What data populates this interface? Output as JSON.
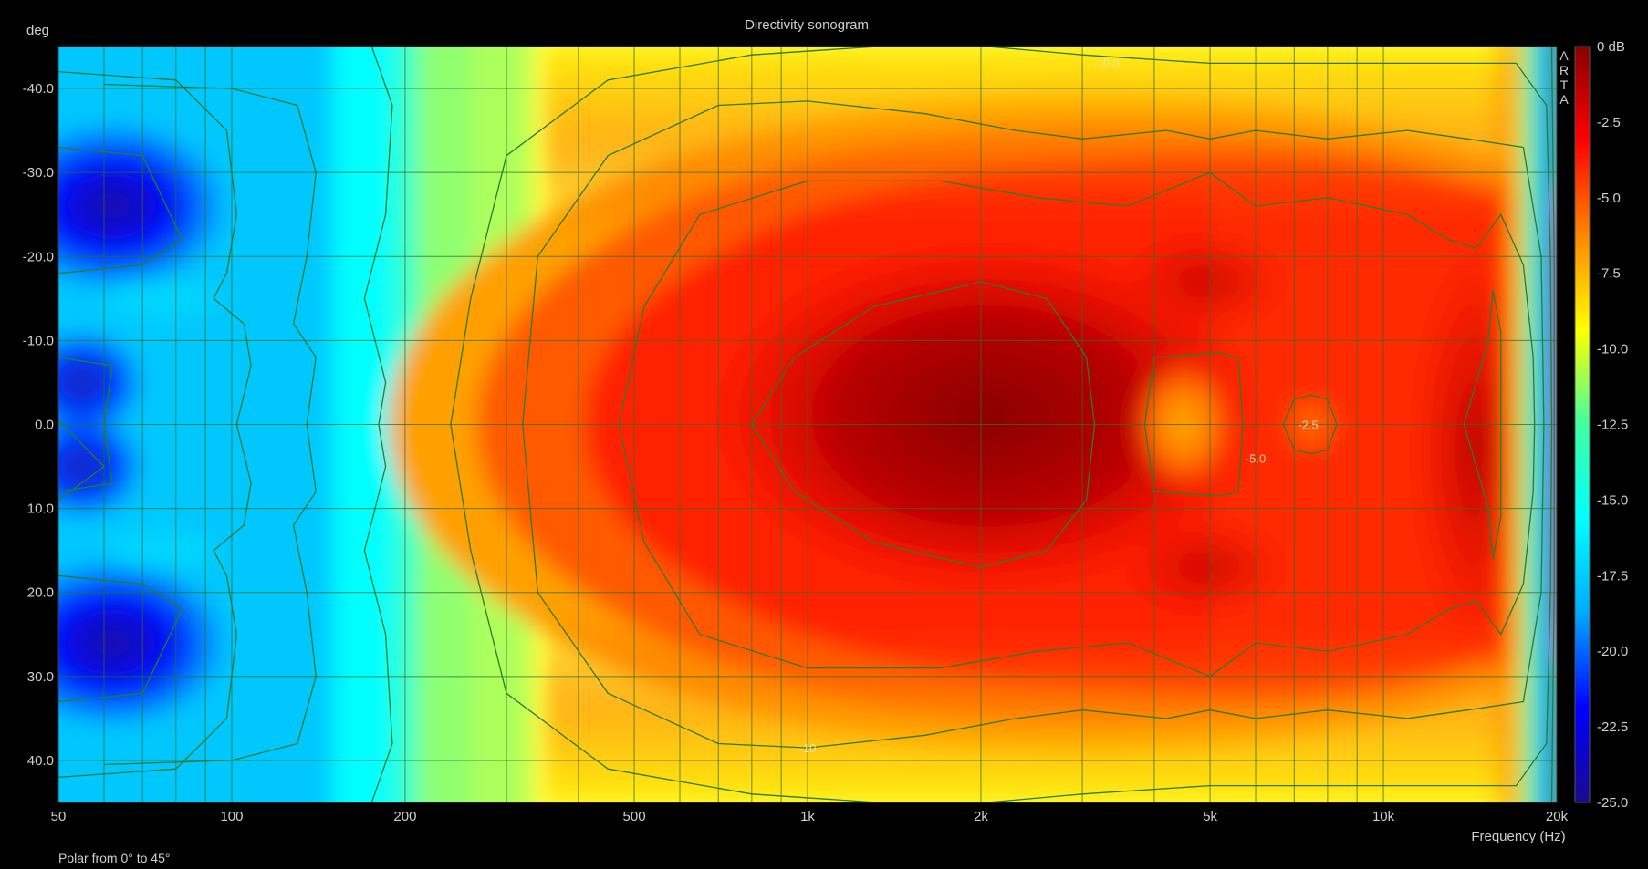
{
  "chart_data": {
    "type": "heatmap",
    "title": "Directivity sonogram",
    "xlabel": "Frequency (Hz)",
    "ylabel": "deg",
    "footer": "Polar from 0° to 45°",
    "watermark": "ARTA",
    "x_scale": "log",
    "xlim": [
      50,
      20000
    ],
    "ylim": [
      -45,
      45
    ],
    "x_ticks": [
      {
        "value": 50,
        "label": "50"
      },
      {
        "value": 100,
        "label": "100"
      },
      {
        "value": 200,
        "label": "200"
      },
      {
        "value": 500,
        "label": "500"
      },
      {
        "value": 1000,
        "label": "1k"
      },
      {
        "value": 2000,
        "label": "2k"
      },
      {
        "value": 5000,
        "label": "5k"
      },
      {
        "value": 10000,
        "label": "10k"
      },
      {
        "value": 20000,
        "label": "20k"
      }
    ],
    "y_ticks": [
      {
        "value": -40,
        "label": "-40.0"
      },
      {
        "value": -30,
        "label": "-30.0"
      },
      {
        "value": -20,
        "label": "-20.0"
      },
      {
        "value": -10,
        "label": "-10.0"
      },
      {
        "value": 0,
        "label": "0.0"
      },
      {
        "value": 10,
        "label": "10.0"
      },
      {
        "value": 20,
        "label": "20.0"
      },
      {
        "value": 30,
        "label": "30.0"
      },
      {
        "value": 40,
        "label": "40.0"
      }
    ],
    "grid": true,
    "colorbar": {
      "range": [
        -25,
        0
      ],
      "placement": "right",
      "colors": [
        "#1a0a8c",
        "#0000ff",
        "#00aaff",
        "#00ffff",
        "#40ffa0",
        "#ffff00",
        "#ff8800",
        "#ff0000",
        "#880000"
      ],
      "ticks": [
        {
          "value": 0,
          "label": "0 dB"
        },
        {
          "value": -2.5,
          "label": "-2.5"
        },
        {
          "value": -5,
          "label": "-5.0"
        },
        {
          "value": -7.5,
          "label": "-7.5"
        },
        {
          "value": -10,
          "label": "-10.0"
        },
        {
          "value": -12.5,
          "label": "-12.5"
        },
        {
          "value": -15,
          "label": "-15.0"
        },
        {
          "value": -17.5,
          "label": "-17.5"
        },
        {
          "value": -20,
          "label": "-20.0"
        },
        {
          "value": -22.5,
          "label": "-22.5"
        },
        {
          "value": -25,
          "label": "-25.0"
        }
      ]
    },
    "contour_color": "#2d7a2d",
    "contour_labels": [
      {
        "text": "-10.0",
        "freq": 3300,
        "deg": -43
      },
      {
        "text": "-2.5",
        "freq": 7400,
        "deg": 0
      },
      {
        "text": "-5.0",
        "freq": 6000,
        "deg": 4
      },
      {
        "text": "-10",
        "freq": 1000,
        "deg": 38.5
      }
    ],
    "contours": [
      {
        "level": -2.5,
        "points": [
          [
            800,
            0
          ],
          [
            950,
            -8
          ],
          [
            1300,
            -14
          ],
          [
            2000,
            -17
          ],
          [
            2600,
            -15
          ],
          [
            3050,
            -8
          ],
          [
            3150,
            0
          ],
          [
            3050,
            9
          ],
          [
            2600,
            15
          ],
          [
            2000,
            17
          ],
          [
            1300,
            14
          ],
          [
            950,
            8
          ],
          [
            800,
            0
          ]
        ]
      },
      {
        "level": -2.5,
        "points": [
          [
            4000,
            -8
          ],
          [
            5200,
            -8.5
          ],
          [
            5600,
            -8
          ],
          [
            5700,
            0
          ],
          [
            5600,
            8
          ],
          [
            5200,
            8.5
          ],
          [
            4000,
            8
          ],
          [
            3850,
            0
          ],
          [
            4000,
            -8
          ]
        ]
      },
      {
        "level": -2.5,
        "points": [
          [
            6700,
            0
          ],
          [
            7000,
            -3
          ],
          [
            7500,
            -3.5
          ],
          [
            8000,
            -3
          ],
          [
            8300,
            0
          ],
          [
            8000,
            3
          ],
          [
            7500,
            3.5
          ],
          [
            7000,
            3
          ],
          [
            6700,
            0
          ]
        ]
      },
      {
        "level": -2.5,
        "points": [
          [
            15500,
            -16
          ],
          [
            16000,
            -11
          ],
          [
            16000,
            0
          ],
          [
            16000,
            11
          ],
          [
            15500,
            16
          ],
          [
            15200,
            10
          ],
          [
            14500,
            5
          ],
          [
            13800,
            0
          ],
          [
            14500,
            -5
          ],
          [
            15200,
            -10
          ],
          [
            15500,
            -16
          ]
        ]
      },
      {
        "level": -5,
        "points": [
          [
            470,
            0
          ],
          [
            520,
            -14
          ],
          [
            650,
            -25
          ],
          [
            1000,
            -29
          ],
          [
            1700,
            -29
          ],
          [
            2500,
            -27
          ],
          [
            3600,
            -26
          ],
          [
            5000,
            -30
          ],
          [
            6000,
            -26
          ],
          [
            8000,
            -27
          ],
          [
            11000,
            -25
          ],
          [
            13000,
            -22
          ],
          [
            14500,
            -21
          ],
          [
            16000,
            -25
          ],
          [
            17500,
            -19
          ],
          [
            18200,
            -8
          ],
          [
            18300,
            0
          ],
          [
            18200,
            8
          ],
          [
            17500,
            19
          ],
          [
            16000,
            25
          ],
          [
            14500,
            21
          ],
          [
            13000,
            22
          ],
          [
            11000,
            25
          ],
          [
            8000,
            27
          ],
          [
            6000,
            26
          ],
          [
            5000,
            30
          ],
          [
            3600,
            26
          ],
          [
            2500,
            27
          ],
          [
            1700,
            29
          ],
          [
            1000,
            29
          ],
          [
            650,
            25
          ],
          [
            520,
            14
          ],
          [
            470,
            0
          ]
        ]
      },
      {
        "level": -7.5,
        "points": [
          [
            320,
            0
          ],
          [
            340,
            -20
          ],
          [
            450,
            -32
          ],
          [
            700,
            -38
          ],
          [
            1000,
            -38.5
          ],
          [
            1600,
            -37
          ],
          [
            2300,
            -35
          ],
          [
            3000,
            -34
          ],
          [
            4200,
            -35
          ],
          [
            5000,
            -34
          ],
          [
            6000,
            -35
          ],
          [
            8000,
            -34
          ],
          [
            11000,
            -35
          ],
          [
            14000,
            -34
          ],
          [
            17500,
            -33
          ],
          [
            18800,
            -20
          ],
          [
            19000,
            0
          ],
          [
            18800,
            20
          ],
          [
            17500,
            33
          ],
          [
            14000,
            34
          ],
          [
            11000,
            35
          ],
          [
            8000,
            34
          ],
          [
            6000,
            35
          ],
          [
            5000,
            34
          ],
          [
            4200,
            35
          ],
          [
            3000,
            34
          ],
          [
            2300,
            35
          ],
          [
            1600,
            37
          ],
          [
            1000,
            38.5
          ],
          [
            700,
            38
          ],
          [
            450,
            32
          ],
          [
            340,
            20
          ],
          [
            320,
            0
          ]
        ]
      },
      {
        "level": -10,
        "points": [
          [
            240,
            0
          ],
          [
            260,
            -15
          ],
          [
            300,
            -32
          ],
          [
            450,
            -41
          ],
          [
            800,
            -44
          ],
          [
            1700,
            -45.5
          ],
          [
            3000,
            -44
          ],
          [
            5000,
            -43
          ],
          [
            8000,
            -43
          ],
          [
            12000,
            -43
          ],
          [
            17000,
            -43
          ],
          [
            19200,
            -38
          ],
          [
            19500,
            -20
          ],
          [
            19600,
            0
          ],
          [
            19500,
            20
          ],
          [
            19200,
            38
          ],
          [
            17000,
            43
          ],
          [
            12000,
            43
          ],
          [
            8000,
            43
          ],
          [
            5000,
            43
          ],
          [
            3000,
            44
          ],
          [
            1700,
            45.5
          ],
          [
            800,
            44
          ],
          [
            450,
            41
          ],
          [
            300,
            32
          ],
          [
            260,
            15
          ],
          [
            240,
            0
          ]
        ]
      },
      {
        "level": -12.5,
        "points": [
          [
            175,
            -45
          ],
          [
            190,
            -38
          ],
          [
            185,
            -25
          ],
          [
            170,
            -15
          ],
          [
            185,
            -5
          ],
          [
            180,
            0
          ],
          [
            185,
            5
          ],
          [
            170,
            15
          ],
          [
            185,
            25
          ],
          [
            190,
            38
          ],
          [
            175,
            45
          ]
        ]
      },
      {
        "level": -12.5,
        "points": [
          [
            19600,
            -45
          ],
          [
            19800,
            -20
          ],
          [
            19800,
            0
          ],
          [
            19800,
            20
          ],
          [
            19600,
            45
          ]
        ]
      },
      {
        "level": -15,
        "points": [
          [
            60,
            -40.5
          ],
          [
            100,
            -40
          ],
          [
            130,
            -38
          ],
          [
            140,
            -30
          ],
          [
            135,
            -20
          ],
          [
            128,
            -12
          ],
          [
            140,
            -8
          ],
          [
            135,
            0
          ],
          [
            140,
            8
          ],
          [
            128,
            12
          ],
          [
            135,
            20
          ],
          [
            140,
            30
          ],
          [
            130,
            38
          ],
          [
            100,
            40
          ],
          [
            60,
            40.5
          ]
        ]
      },
      {
        "level": -17.5,
        "points": [
          [
            50,
            -42
          ],
          [
            80,
            -41
          ],
          [
            98,
            -35
          ],
          [
            102,
            -25
          ],
          [
            98,
            -18
          ],
          [
            93,
            -15
          ],
          [
            105,
            -12
          ],
          [
            108,
            -7
          ],
          [
            102,
            0
          ],
          [
            108,
            7
          ],
          [
            105,
            12
          ],
          [
            93,
            15
          ],
          [
            98,
            18
          ],
          [
            102,
            25
          ],
          [
            98,
            35
          ],
          [
            80,
            41
          ],
          [
            50,
            42
          ]
        ]
      },
      {
        "level": -20,
        "points": [
          [
            50,
            -33
          ],
          [
            70,
            -32
          ],
          [
            82,
            -22
          ],
          [
            70,
            -19
          ],
          [
            50,
            -18
          ]
        ]
      },
      {
        "level": -20,
        "points": [
          [
            50,
            -8
          ],
          [
            62,
            -7
          ],
          [
            60,
            0
          ],
          [
            62,
            7
          ],
          [
            50,
            8
          ]
        ]
      },
      {
        "level": -20,
        "points": [
          [
            50,
            18
          ],
          [
            70,
            19
          ],
          [
            82,
            22
          ],
          [
            70,
            32
          ],
          [
            50,
            33
          ]
        ]
      },
      {
        "level": -17.5,
        "points": [
          [
            50,
            -0.5
          ],
          [
            60,
            5
          ],
          [
            50,
            9
          ]
        ]
      }
    ]
  }
}
